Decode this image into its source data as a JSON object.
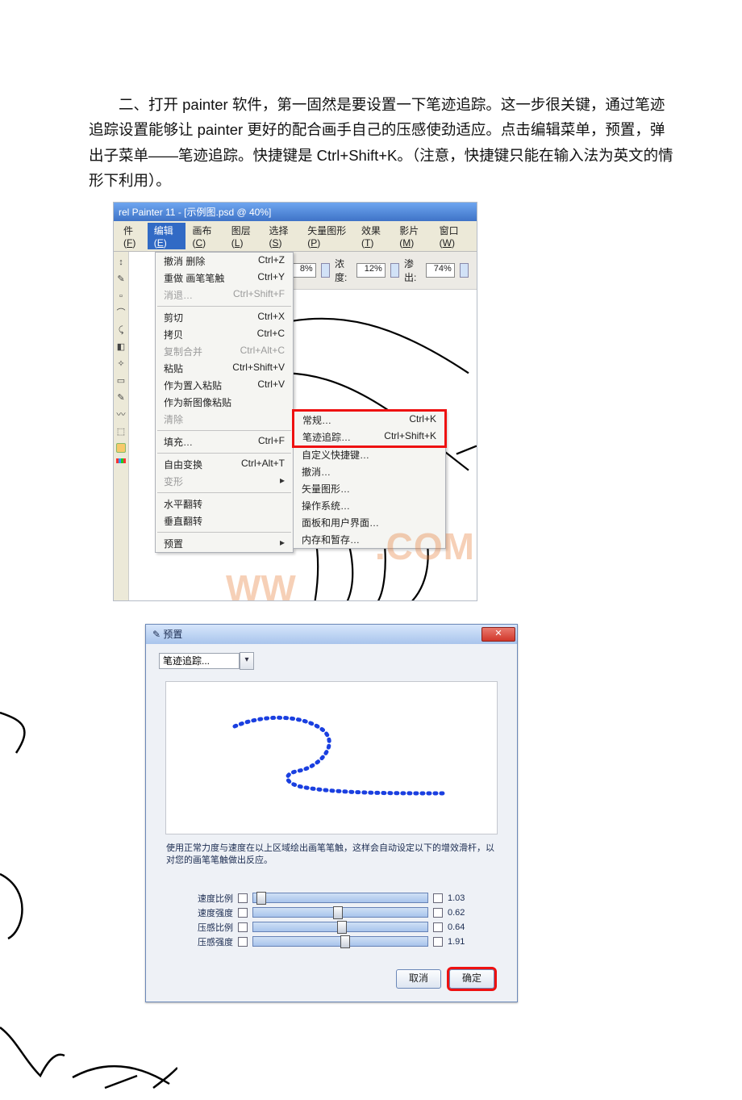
{
  "paragraph": "　　二、打开 painter 软件，第一固然是要设置一下笔迹追踪。这一步很关键，通过笔迹追踪设置能够让 painter 更好的配合画手自己的压感使劲适应。点击编辑菜单，预置，弹出子菜单——笔迹追踪。快捷键是 Ctrl+Shift+K。（注意，快捷键只能在输入法为英文的情形下利用）。",
  "painter": {
    "title": "rel Painter 11 - [示例图.psd @ 40%]",
    "menubar": {
      "file": {
        "label": "件",
        "accel": "F"
      },
      "edit": {
        "label": "编辑",
        "accel": "E"
      },
      "canvas": {
        "label": "画布",
        "accel": "C"
      },
      "layer": {
        "label": "图层",
        "accel": "L"
      },
      "select": {
        "label": "选择",
        "accel": "S"
      },
      "shapes": {
        "label": "矢量图形",
        "accel": "P"
      },
      "effects": {
        "label": "效果",
        "accel": "T"
      },
      "movie": {
        "label": "影片",
        "accel": "M"
      },
      "window": {
        "label": "窗口",
        "accel": "W"
      }
    },
    "options": {
      "size_value": "8%",
      "opacity_label": "浓度:",
      "opacity_value": "12%",
      "bleed_label": "渗出:",
      "bleed_value": "74%"
    },
    "edit_menu": [
      {
        "label": "撤消 删除",
        "shortcut": "Ctrl+Z",
        "disabled": false
      },
      {
        "label": "重做 画笔笔触",
        "shortcut": "Ctrl+Y",
        "disabled": false
      },
      {
        "label": "消退…",
        "shortcut": "Ctrl+Shift+F",
        "disabled": true
      },
      {
        "sep": true
      },
      {
        "label": "剪切",
        "shortcut": "Ctrl+X",
        "disabled": false
      },
      {
        "label": "拷贝",
        "shortcut": "Ctrl+C",
        "disabled": false
      },
      {
        "label": "复制合并",
        "shortcut": "Ctrl+Alt+C",
        "disabled": true
      },
      {
        "label": "粘贴",
        "shortcut": "Ctrl+Shift+V",
        "disabled": false
      },
      {
        "label": "作为置入粘贴",
        "shortcut": "Ctrl+V",
        "disabled": false
      },
      {
        "label": "作为新图像粘贴",
        "shortcut": "",
        "disabled": false
      },
      {
        "label": "清除",
        "shortcut": "",
        "disabled": true
      },
      {
        "sep": true
      },
      {
        "label": "填充…",
        "shortcut": "Ctrl+F",
        "disabled": false
      },
      {
        "sep": true
      },
      {
        "label": "自由变换",
        "shortcut": "Ctrl+Alt+T",
        "disabled": false
      },
      {
        "label": "变形",
        "shortcut": "",
        "disabled": true,
        "arrow": true
      },
      {
        "sep": true
      },
      {
        "label": "水平翻转",
        "shortcut": "",
        "disabled": false
      },
      {
        "label": "垂直翻转",
        "shortcut": "",
        "disabled": false
      },
      {
        "sep": true
      },
      {
        "label": "预置",
        "shortcut": "",
        "disabled": false,
        "arrow": true
      }
    ],
    "submenu": [
      {
        "label": "常规…",
        "shortcut": "Ctrl+K",
        "highlight": true
      },
      {
        "label": "笔迹追踪…",
        "shortcut": "Ctrl+Shift+K",
        "highlight": true
      },
      {
        "label": "自定义快捷键…",
        "shortcut": "",
        "highlight": false
      },
      {
        "label": "撤消…",
        "shortcut": "",
        "highlight": false
      },
      {
        "label": "矢量图形…",
        "shortcut": "",
        "highlight": false
      },
      {
        "label": "操作系统…",
        "shortcut": "",
        "highlight": false
      },
      {
        "label": "面板和用户界面…",
        "shortcut": "",
        "highlight": false
      },
      {
        "label": "内存和暂存…",
        "shortcut": "",
        "highlight": false
      }
    ],
    "watermark_left": "WW",
    "watermark_right": ".COM"
  },
  "prefs": {
    "title_icon": "✎",
    "title": "预置",
    "close": "✕",
    "selector_value": "笔迹追踪...",
    "hint": "使用正常力度与速度在以上区域绘出画笔笔触，这样会自动设定以下的增效滑杆，以对您的画笔笔触做出反应。",
    "sliders": [
      {
        "label": "速度比例",
        "value": "1.03",
        "pos": 2
      },
      {
        "label": "速度强度",
        "value": "0.62",
        "pos": 46
      },
      {
        "label": "压感比例",
        "value": "0.64",
        "pos": 48
      },
      {
        "label": "压感强度",
        "value": "1.91",
        "pos": 50
      }
    ],
    "btn_cancel": "取消",
    "btn_ok": "确定"
  }
}
